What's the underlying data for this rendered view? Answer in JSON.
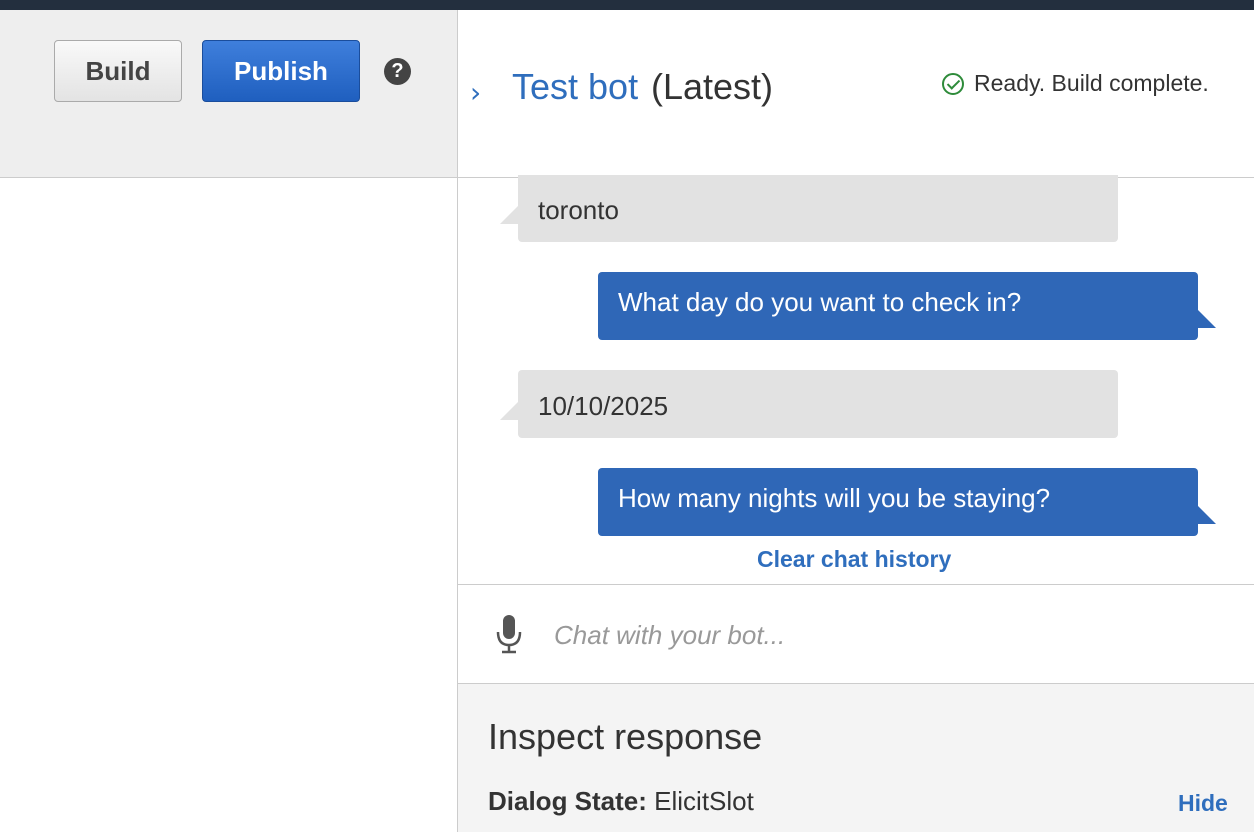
{
  "toolbar": {
    "build_label": "Build",
    "publish_label": "Publish",
    "help_glyph": "?"
  },
  "test_bot": {
    "chevron": "›",
    "title": "Test bot",
    "version": "(Latest)",
    "status": "Ready. Build complete.",
    "status_icon": "check-circle-icon",
    "status_color": "#2e8b3a"
  },
  "chat": {
    "messages": [
      {
        "from": "user",
        "text": "toronto"
      },
      {
        "from": "bot",
        "text": "What day do you want to check in?"
      },
      {
        "from": "user",
        "text": "10/10/2025"
      },
      {
        "from": "bot",
        "text": "How many nights will you be staying?"
      }
    ],
    "clear_label": "Clear chat history",
    "input_placeholder": "Chat with your bot...",
    "input_value": "",
    "mic_icon": "microphone-icon"
  },
  "inspect": {
    "title": "Inspect response",
    "dialog_state_label": "Dialog State:",
    "dialog_state_value": "ElicitSlot",
    "hide_label": "Hide"
  },
  "colors": {
    "accent": "#2f6ebd",
    "bot_bubble": "#2f67b7",
    "user_bubble": "#e2e2e2",
    "header_bg": "#232f3e"
  }
}
